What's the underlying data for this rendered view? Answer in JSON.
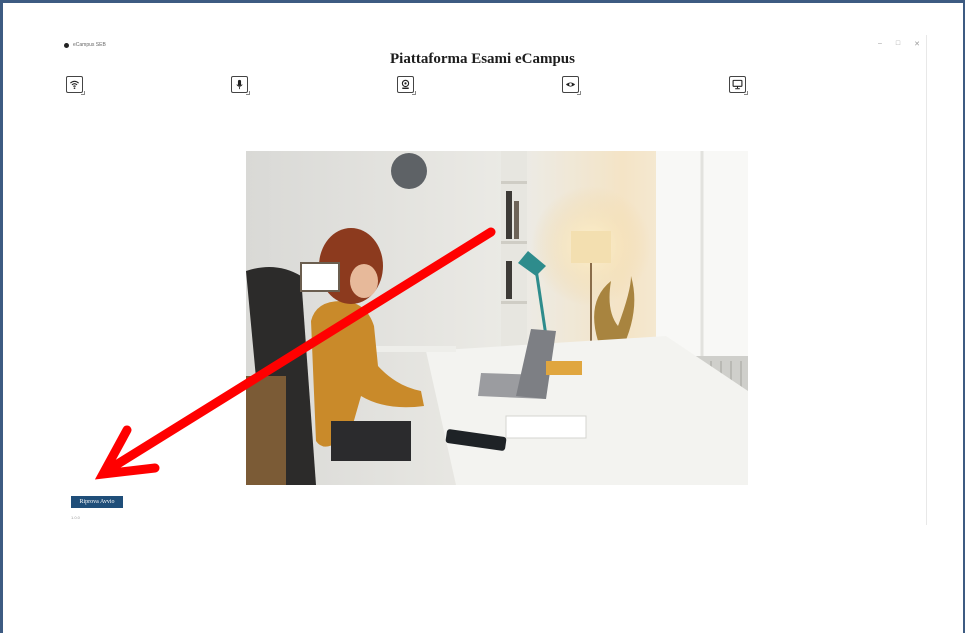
{
  "app": {
    "window_title": "eCampus SEB",
    "page_title": "Piattaforma Esami eCampus",
    "version": "1.0.0"
  },
  "window_controls": {
    "minimize": "–",
    "maximize": "□",
    "close": "✕"
  },
  "toolbar": {
    "icons": [
      "wifi-icon",
      "microphone-icon",
      "webcam-icon",
      "eye-icon",
      "monitor-icon"
    ]
  },
  "actions": {
    "retry_label": "Riprova Avvio"
  },
  "annotation": {
    "arrow_color": "#ff0000"
  },
  "colors": {
    "frame": "#3d5b82",
    "button": "#1f4e79"
  }
}
